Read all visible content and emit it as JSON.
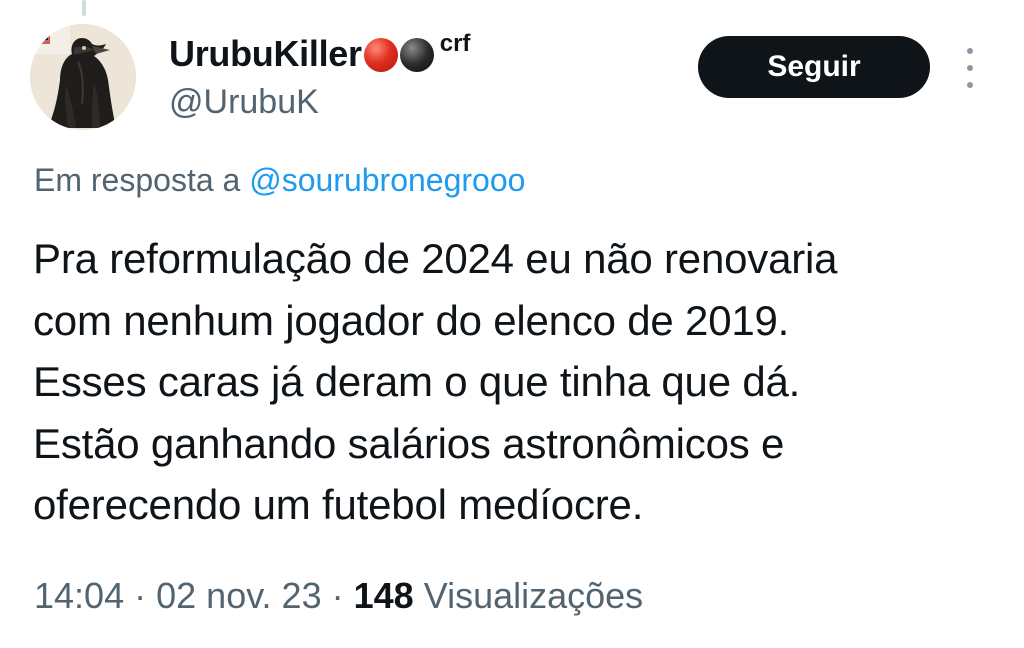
{
  "tweet": {
    "author": {
      "display_name": "UrubuKiller",
      "name_suffix": "crf",
      "handle": "@UrubuK",
      "avatar_icon": "vulture-avatar-icon",
      "name_emojis": [
        "red-circle-emoji",
        "black-circle-emoji"
      ]
    },
    "follow_label": "Seguir",
    "more_icon": "more-vertical-icon",
    "reply_prefix": "Em resposta a",
    "reply_to": "@sourubronegrooo",
    "text_lines": [
      "Pra reformulação de 2024 eu não renovaria",
      "com nenhum jogador do elenco de 2019.",
      "Esses caras já deram o que tinha que dá.",
      "Estão ganhando salários astronômicos e",
      "oferecendo um futebol medíocre."
    ],
    "time": "14:04",
    "separator": "·",
    "date": "02 nov. 23",
    "views_count": "148",
    "views_label": "Visualizações"
  },
  "colors": {
    "text_primary": "#0f1419",
    "text_secondary": "#536471",
    "link": "#1d9bf0",
    "button_bg": "#0f1419",
    "button_text": "#ffffff"
  }
}
